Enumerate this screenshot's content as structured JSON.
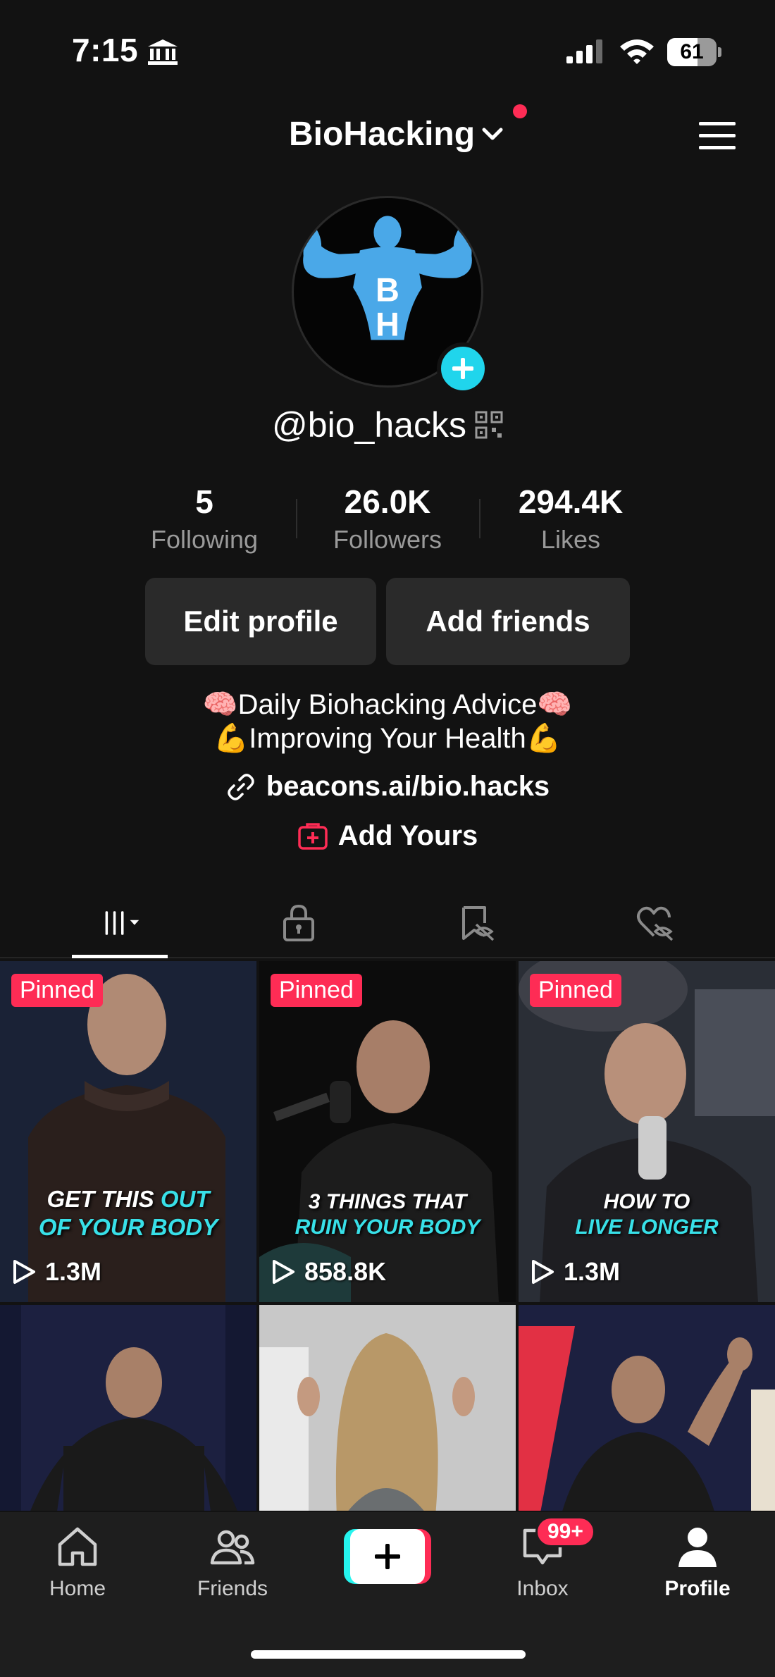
{
  "status_bar": {
    "time": "7:15",
    "battery_level": 61,
    "battery_label": "61",
    "icons": [
      "bank-icon",
      "cellular-signal-icon",
      "wifi-icon",
      "battery-icon"
    ]
  },
  "header": {
    "account_name": "BioHacking",
    "has_notification": true,
    "icons": [
      "chevron-down-icon",
      "menu-icon"
    ]
  },
  "profile": {
    "avatar_letters": [
      "B",
      "H"
    ],
    "username": "@bio_hacks",
    "stats": [
      {
        "value": "5",
        "label": "Following"
      },
      {
        "value": "26.0K",
        "label": "Followers"
      },
      {
        "value": "294.4K",
        "label": "Likes"
      }
    ],
    "buttons": {
      "edit": "Edit profile",
      "add_friends": "Add friends"
    },
    "bio_lines": [
      "🧠Daily Biohacking Advice🧠",
      "💪Improving Your Health💪"
    ],
    "link": "beacons.ai/bio.hacks",
    "add_yours": "Add Yours"
  },
  "tabs": [
    {
      "icon": "videos-grid-icon",
      "active": true
    },
    {
      "icon": "lock-icon",
      "active": false
    },
    {
      "icon": "hidden-bookmark-icon",
      "active": false
    },
    {
      "icon": "hidden-heart-icon",
      "active": false
    }
  ],
  "videos": [
    {
      "pinned_label": "Pinned",
      "overlay": [
        "GET THIS ",
        "OUT",
        "OF YOUR BODY"
      ],
      "views": "1.3M"
    },
    {
      "pinned_label": "Pinned",
      "overlay": [
        "3 THINGS THAT",
        "RUIN YOUR BODY"
      ],
      "views": "858.8K"
    },
    {
      "pinned_label": "Pinned",
      "overlay": [
        "HOW TO",
        "LIVE LONGER"
      ],
      "views": "1.3M"
    },
    {
      "pinned_label": "",
      "overlay": [],
      "views": ""
    },
    {
      "pinned_label": "",
      "overlay": [],
      "views": ""
    },
    {
      "pinned_label": "",
      "overlay": [],
      "views": ""
    }
  ],
  "bottom_nav": {
    "items": [
      {
        "label": "Home",
        "icon": "home-icon"
      },
      {
        "label": "Friends",
        "icon": "friends-icon"
      },
      {
        "label": "",
        "icon": "create-plus-icon"
      },
      {
        "label": "Inbox",
        "icon": "inbox-icon"
      },
      {
        "label": "Profile",
        "icon": "profile-icon",
        "active": true
      }
    ],
    "inbox_badge": "99+"
  },
  "colors": {
    "background": "#121212",
    "accent_red": "#fe2c55",
    "accent_cyan": "#25f4ee",
    "avatar_figure": "#4aa8e8",
    "overlay_cyan": "#38e0e8"
  }
}
